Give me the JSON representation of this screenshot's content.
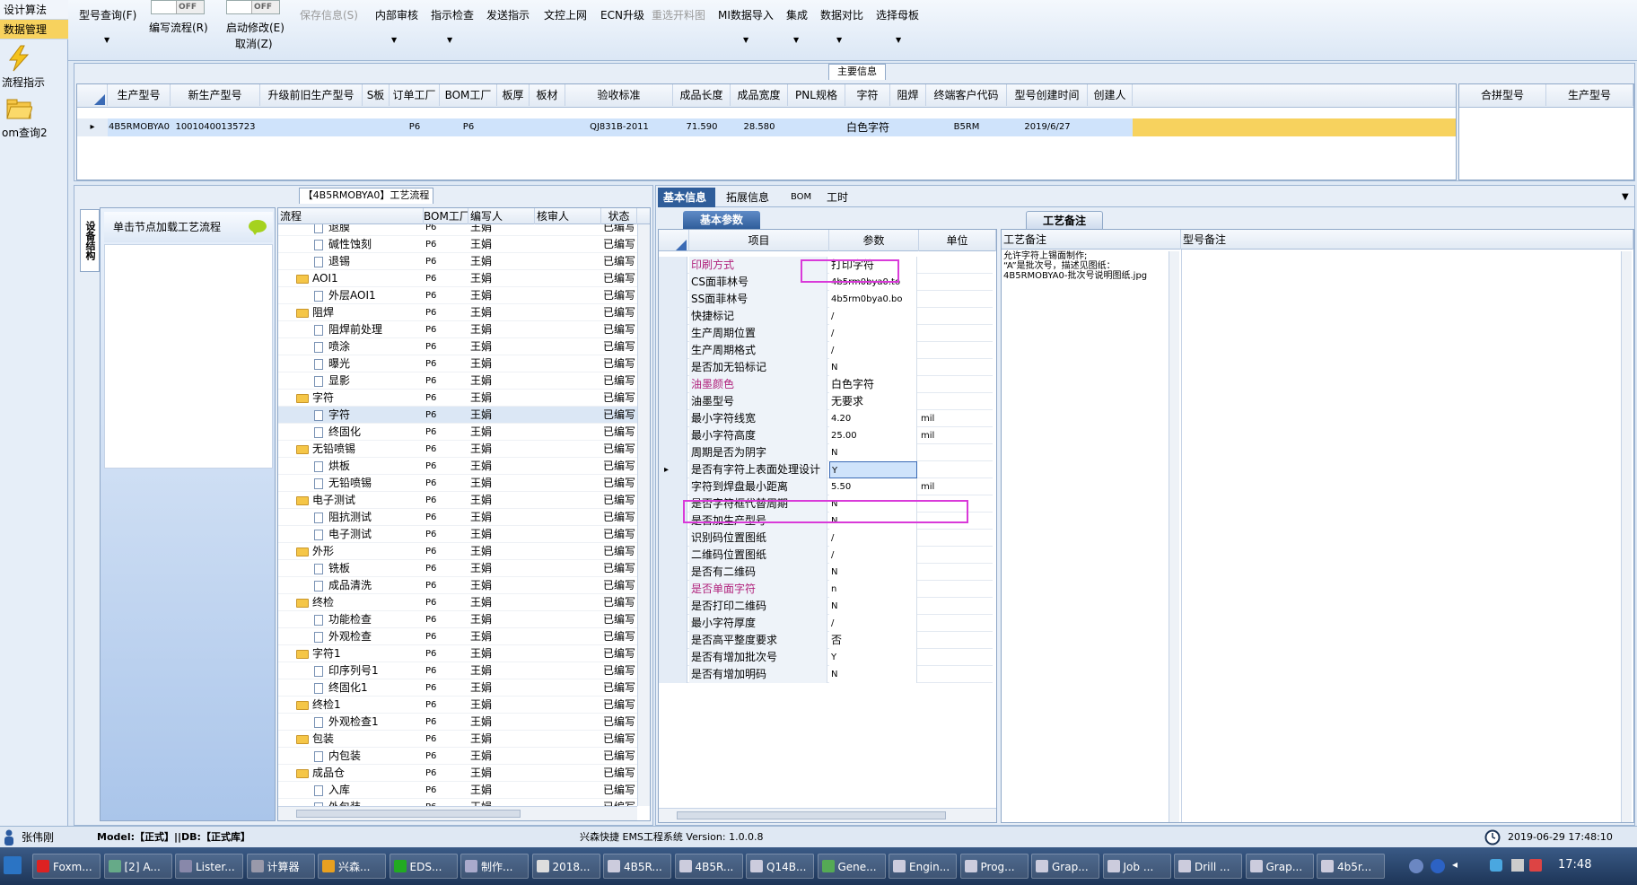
{
  "leftnav": {
    "items": [
      {
        "label": "设计算法"
      },
      {
        "label": "数据管理"
      }
    ],
    "big_items": [
      {
        "label": "流程指示",
        "icon": "lightning-icon"
      },
      {
        "label": "om查询2",
        "icon": "folder-icon"
      }
    ]
  },
  "toolbar": {
    "toggle_state": "OFF",
    "buttons": [
      {
        "label": "型号查询(F)",
        "enabled": true
      },
      {
        "label": "编写流程(R)",
        "enabled": true
      },
      {
        "label": "启动修改(E)",
        "enabled": true
      },
      {
        "label": "取消(Z)",
        "enabled": true
      },
      {
        "label": "保存信息(S)",
        "enabled": false
      },
      {
        "label": "内部审核",
        "enabled": true
      },
      {
        "label": "指示检查",
        "enabled": true
      },
      {
        "label": "发送指示",
        "enabled": true
      },
      {
        "label": "文控上网",
        "enabled": true
      },
      {
        "label": "ECN升级",
        "enabled": true
      },
      {
        "label": "重选开料图",
        "enabled": false
      },
      {
        "label": "MI数据导入",
        "enabled": true
      },
      {
        "label": "集成",
        "enabled": true
      },
      {
        "label": "数据对比",
        "enabled": true
      },
      {
        "label": "选择母板",
        "enabled": true
      }
    ]
  },
  "main_info": {
    "title": "主要信息",
    "columns": [
      "生产型号",
      "新生产型号",
      "升级前旧生产型号",
      "S板",
      "订单工厂",
      "BOM工厂",
      "板厚",
      "板材",
      "验收标准",
      "成品长度",
      "成品宽度",
      "PNL规格",
      "字符",
      "阻焊",
      "终端客户代码",
      "型号创建时间",
      "创建人"
    ],
    "row": [
      "4B5RMOBYA0",
      "10010400135723",
      "",
      "",
      "P6",
      "P6",
      "",
      "",
      "QJ831B-2011",
      "71.590",
      "28.580",
      "",
      "白色字符",
      "",
      "B5RM",
      "2019/6/27",
      ""
    ],
    "side_columns": [
      "合拼型号",
      "生产型号"
    ]
  },
  "process": {
    "title": "【4B5RMOBYA0】工艺流程",
    "vertical_tab": "设备结构",
    "hint": "单击节点加载工艺流程",
    "columns": [
      "流程",
      "BOM工厂",
      "编写人",
      "核审人",
      "状态"
    ],
    "rows": [
      {
        "name": "退膜",
        "level": 2,
        "type": "doc",
        "bom": "P6",
        "writer": "王娟",
        "status": "已编写"
      },
      {
        "name": "碱性蚀刻",
        "level": 2,
        "type": "doc",
        "bom": "P6",
        "writer": "王娟",
        "status": "已编写"
      },
      {
        "name": "退锡",
        "level": 2,
        "type": "doc",
        "bom": "P6",
        "writer": "王娟",
        "status": "已编写"
      },
      {
        "name": "AOI1",
        "level": 1,
        "type": "folder",
        "bom": "P6",
        "writer": "王娟",
        "status": "已编写"
      },
      {
        "name": "外层AOI1",
        "level": 2,
        "type": "doc",
        "bom": "P6",
        "writer": "王娟",
        "status": "已编写"
      },
      {
        "name": "阻焊",
        "level": 1,
        "type": "folder",
        "bom": "P6",
        "writer": "王娟",
        "status": "已编写"
      },
      {
        "name": "阻焊前处理",
        "level": 2,
        "type": "doc",
        "bom": "P6",
        "writer": "王娟",
        "status": "已编写"
      },
      {
        "name": "喷涂",
        "level": 2,
        "type": "doc",
        "bom": "P6",
        "writer": "王娟",
        "status": "已编写"
      },
      {
        "name": "曝光",
        "level": 2,
        "type": "doc",
        "bom": "P6",
        "writer": "王娟",
        "status": "已编写"
      },
      {
        "name": "显影",
        "level": 2,
        "type": "doc",
        "bom": "P6",
        "writer": "王娟",
        "status": "已编写"
      },
      {
        "name": "字符",
        "level": 1,
        "type": "folder",
        "bom": "P6",
        "writer": "王娟",
        "status": "已编写"
      },
      {
        "name": "字符",
        "level": 2,
        "type": "doc",
        "bom": "P6",
        "writer": "王娟",
        "status": "已编写",
        "selected": true
      },
      {
        "name": "终固化",
        "level": 2,
        "type": "doc",
        "bom": "P6",
        "writer": "王娟",
        "status": "已编写"
      },
      {
        "name": "无铅喷锡",
        "level": 1,
        "type": "folder",
        "bom": "P6",
        "writer": "王娟",
        "status": "已编写"
      },
      {
        "name": "烘板",
        "level": 2,
        "type": "doc",
        "bom": "P6",
        "writer": "王娟",
        "status": "已编写"
      },
      {
        "name": "无铅喷锡",
        "level": 2,
        "type": "doc",
        "bom": "P6",
        "writer": "王娟",
        "status": "已编写"
      },
      {
        "name": "电子测试",
        "level": 1,
        "type": "folder",
        "bom": "P6",
        "writer": "王娟",
        "status": "已编写"
      },
      {
        "name": "阻抗测试",
        "level": 2,
        "type": "doc",
        "bom": "P6",
        "writer": "王娟",
        "status": "已编写"
      },
      {
        "name": "电子测试",
        "level": 2,
        "type": "doc",
        "bom": "P6",
        "writer": "王娟",
        "status": "已编写"
      },
      {
        "name": "外形",
        "level": 1,
        "type": "folder",
        "bom": "P6",
        "writer": "王娟",
        "status": "已编写"
      },
      {
        "name": "铣板",
        "level": 2,
        "type": "doc",
        "bom": "P6",
        "writer": "王娟",
        "status": "已编写"
      },
      {
        "name": "成品清洗",
        "level": 2,
        "type": "doc",
        "bom": "P6",
        "writer": "王娟",
        "status": "已编写"
      },
      {
        "name": "终检",
        "level": 1,
        "type": "folder",
        "bom": "P6",
        "writer": "王娟",
        "status": "已编写"
      },
      {
        "name": "功能检查",
        "level": 2,
        "type": "doc",
        "bom": "P6",
        "writer": "王娟",
        "status": "已编写"
      },
      {
        "name": "外观检查",
        "level": 2,
        "type": "doc",
        "bom": "P6",
        "writer": "王娟",
        "status": "已编写"
      },
      {
        "name": "字符1",
        "level": 1,
        "type": "folder",
        "bom": "P6",
        "writer": "王娟",
        "status": "已编写"
      },
      {
        "name": "印序列号1",
        "level": 2,
        "type": "doc",
        "bom": "P6",
        "writer": "王娟",
        "status": "已编写"
      },
      {
        "name": "终固化1",
        "level": 2,
        "type": "doc",
        "bom": "P6",
        "writer": "王娟",
        "status": "已编写"
      },
      {
        "name": "终检1",
        "level": 1,
        "type": "folder",
        "bom": "P6",
        "writer": "王娟",
        "status": "已编写"
      },
      {
        "name": "外观检查1",
        "level": 2,
        "type": "doc",
        "bom": "P6",
        "writer": "王娟",
        "status": "已编写"
      },
      {
        "name": "包装",
        "level": 1,
        "type": "folder",
        "bom": "P6",
        "writer": "王娟",
        "status": "已编写"
      },
      {
        "name": "内包装",
        "level": 2,
        "type": "doc",
        "bom": "P6",
        "writer": "王娟",
        "status": "已编写"
      },
      {
        "name": "成品仓",
        "level": 1,
        "type": "folder",
        "bom": "P6",
        "writer": "王娟",
        "status": "已编写"
      },
      {
        "name": "入库",
        "level": 2,
        "type": "doc",
        "bom": "P6",
        "writer": "王娟",
        "status": "已编写"
      },
      {
        "name": "外包装",
        "level": 2,
        "type": "doc",
        "bom": "P6",
        "writer": "王娟",
        "status": "已编写"
      }
    ]
  },
  "detail": {
    "tabs": [
      "基本信息",
      "拓展信息",
      "BOM",
      "工时"
    ],
    "subtab": "基本参数",
    "columns": [
      "项目",
      "参数",
      "单位"
    ],
    "params": [
      {
        "k": "印刷方式",
        "v": "打印字符",
        "u": "",
        "pink": true,
        "hl": true
      },
      {
        "k": "CS面菲林号",
        "v": "4b5rm0bya0.to",
        "u": ""
      },
      {
        "k": "SS面菲林号",
        "v": "4b5rm0bya0.bo",
        "u": ""
      },
      {
        "k": "快捷标记",
        "v": "/",
        "u": ""
      },
      {
        "k": "生产周期位置",
        "v": "/",
        "u": ""
      },
      {
        "k": "生产周期格式",
        "v": "/",
        "u": ""
      },
      {
        "k": "是否加无铅标记",
        "v": "N",
        "u": ""
      },
      {
        "k": "油墨颜色",
        "v": "白色字符",
        "u": "",
        "pink": true
      },
      {
        "k": "油墨型号",
        "v": "无要求",
        "u": ""
      },
      {
        "k": "最小字符线宽",
        "v": "4.20",
        "u": "mil"
      },
      {
        "k": "最小字符高度",
        "v": "25.00",
        "u": "mil"
      },
      {
        "k": "周期是否为阴字",
        "v": "N",
        "u": ""
      },
      {
        "k": "是否有字符上表面处理设计",
        "v": "Y",
        "u": "",
        "hl": true,
        "current": true
      },
      {
        "k": "字符到焊盘最小距离",
        "v": "5.50",
        "u": "mil"
      },
      {
        "k": "是否字符框代替周期",
        "v": "N",
        "u": ""
      },
      {
        "k": "是否加生产型号",
        "v": "N",
        "u": ""
      },
      {
        "k": "识别码位置图纸",
        "v": "/",
        "u": ""
      },
      {
        "k": "二维码位置图纸",
        "v": "/",
        "u": ""
      },
      {
        "k": "是否有二维码",
        "v": "N",
        "u": ""
      },
      {
        "k": "是否单面字符",
        "v": "n",
        "u": "",
        "pink": true
      },
      {
        "k": "是否打印二维码",
        "v": "N",
        "u": ""
      },
      {
        "k": "最小字符厚度",
        "v": "/",
        "u": ""
      },
      {
        "k": "是否高平整度要求",
        "v": "否",
        "u": ""
      },
      {
        "k": "是否有增加批次号",
        "v": "Y",
        "u": ""
      },
      {
        "k": "是否有增加明码",
        "v": "N",
        "u": ""
      }
    ],
    "remark_tab": "工艺备注",
    "remark_header": "工艺备注",
    "model_remark_header": "型号备注",
    "remark_lines": [
      "允许字符上锡面制作;",
      "“A”是批次号，描述见图纸：",
      "4B5RMOBYA0-批次号说明图纸.jpg"
    ]
  },
  "status": {
    "user": "张伟刚",
    "model": "Model:【正式】||DB:【正式库】",
    "system": "兴森快捷 EMS工程系统 Version: 1.0.0.8",
    "datetime": "2019-06-29 17:48:10"
  },
  "taskbar": {
    "tasks": [
      {
        "label": "Foxm...",
        "color": "#d22"
      },
      {
        "label": "[2] A...",
        "color": "#6a8"
      },
      {
        "label": "Lister...",
        "color": "#88a"
      },
      {
        "label": "计算器",
        "color": "#99a"
      },
      {
        "label": "兴森...",
        "color": "#e8a020"
      },
      {
        "label": "EDS...",
        "color": "#2a2"
      },
      {
        "label": "制作...",
        "color": "#aac"
      },
      {
        "label": "2018...",
        "color": "#ddd"
      },
      {
        "label": "4B5R...",
        "color": "#ccd"
      },
      {
        "label": "4B5R...",
        "color": "#ccd"
      },
      {
        "label": "Q14B...",
        "color": "#ccd"
      },
      {
        "label": "Gene...",
        "color": "#5a5"
      },
      {
        "label": "Engin...",
        "color": "#ccd"
      },
      {
        "label": "Prog...",
        "color": "#ccd"
      },
      {
        "label": "Grap...",
        "color": "#ccd"
      },
      {
        "label": "Job ...",
        "color": "#ccd"
      },
      {
        "label": "Drill ...",
        "color": "#ccd"
      },
      {
        "label": "Grap...",
        "color": "#ccd"
      },
      {
        "label": "4b5r...",
        "color": "#ccd"
      }
    ],
    "clock": "17:48"
  }
}
